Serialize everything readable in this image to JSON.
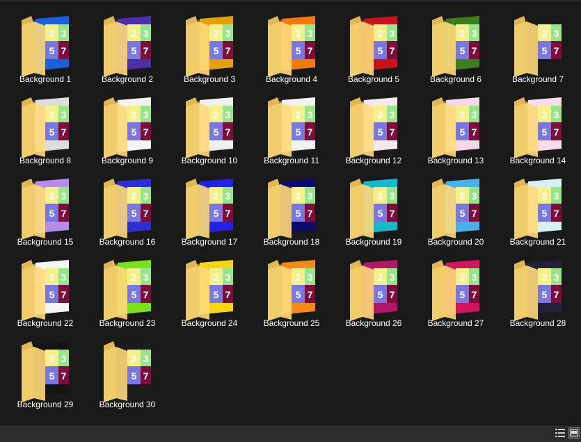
{
  "folders": [
    {
      "name": "Background 1",
      "accent": "#1d5fd6"
    },
    {
      "name": "Background 2",
      "accent": "#4b2fa8"
    },
    {
      "name": "Background 3",
      "accent": "#e0a10b"
    },
    {
      "name": "Background 4",
      "accent": "#ee7a13"
    },
    {
      "name": "Background 5",
      "accent": "#c8141e"
    },
    {
      "name": "Background 6",
      "accent": "#3d7d1f"
    },
    {
      "name": "Background 7",
      "accent": "#1a1a1a"
    },
    {
      "name": "Background 8",
      "accent": "#dcdcdc"
    },
    {
      "name": "Background 9",
      "accent": "#f4f4f4"
    },
    {
      "name": "Background 10",
      "accent": "#f0f0f0"
    },
    {
      "name": "Background 11",
      "accent": "#f2f2f2"
    },
    {
      "name": "Background 12",
      "accent": "#f5e9ef"
    },
    {
      "name": "Background 13",
      "accent": "#f3d9e6"
    },
    {
      "name": "Background 14",
      "accent": "#f7dced"
    },
    {
      "name": "Background 15",
      "accent": "#b58de6"
    },
    {
      "name": "Background 16",
      "accent": "#2e2fd2"
    },
    {
      "name": "Background 17",
      "accent": "#2222e0"
    },
    {
      "name": "Background 18",
      "accent": "#0b0b6a"
    },
    {
      "name": "Background 19",
      "accent": "#18b7c9"
    },
    {
      "name": "Background 20",
      "accent": "#4ab0ea"
    },
    {
      "name": "Background 21",
      "accent": "#d9f0f5"
    },
    {
      "name": "Background 22",
      "accent": "#f5f5f5"
    },
    {
      "name": "Background 23",
      "accent": "#7be01e"
    },
    {
      "name": "Background 24",
      "accent": "#f5d419"
    },
    {
      "name": "Background 25",
      "accent": "#f28a1c"
    },
    {
      "name": "Background 26",
      "accent": "#b01869"
    },
    {
      "name": "Background 27",
      "accent": "#d0155f"
    },
    {
      "name": "Background 28",
      "accent": "#23203a"
    },
    {
      "name": "Background 29",
      "accent": "#141414"
    },
    {
      "name": "Background 30",
      "accent": "#1c1c1c"
    }
  ],
  "thumbnail_numbers": [
    "2",
    "3",
    "5",
    "7"
  ],
  "statusbar": {
    "details_view_icon": "details-view-icon",
    "large_icons_view_icon": "large-icons-view-icon"
  }
}
